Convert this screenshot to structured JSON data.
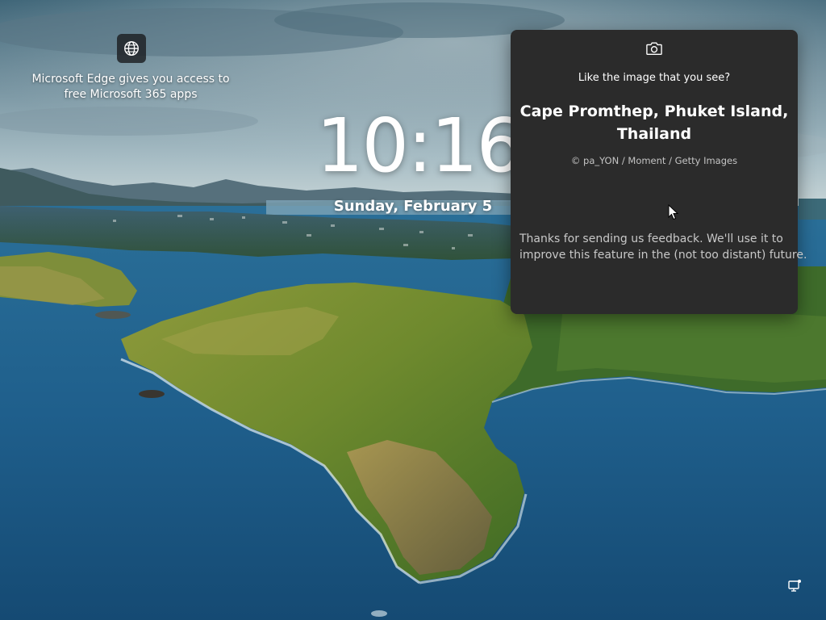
{
  "lock_screen": {
    "edge_tip": {
      "line1": "Microsoft Edge gives you access to",
      "line2": "free Microsoft 365 apps",
      "icon": "globe-icon"
    },
    "clock": {
      "time": "10:16",
      "date": "Sunday, February 5"
    },
    "spotlight": {
      "camera_icon": "camera-icon",
      "question": "Like the image that you see?",
      "title_line1": "Cape Promthep, Phuket Island,",
      "title_line2": "Thailand",
      "credit": "© pa_YON / Moment / Getty Images",
      "feedback_line1": "Thanks for sending us feedback. We'll use it to",
      "feedback_line2": "improve this feature in the (not too distant) future."
    },
    "network_icon": "network-icon"
  },
  "colors": {
    "panel_background": "#2b2b2b",
    "sea": "#1d5a86",
    "text": "#ffffff",
    "muted_text": "#c8c8c8"
  }
}
